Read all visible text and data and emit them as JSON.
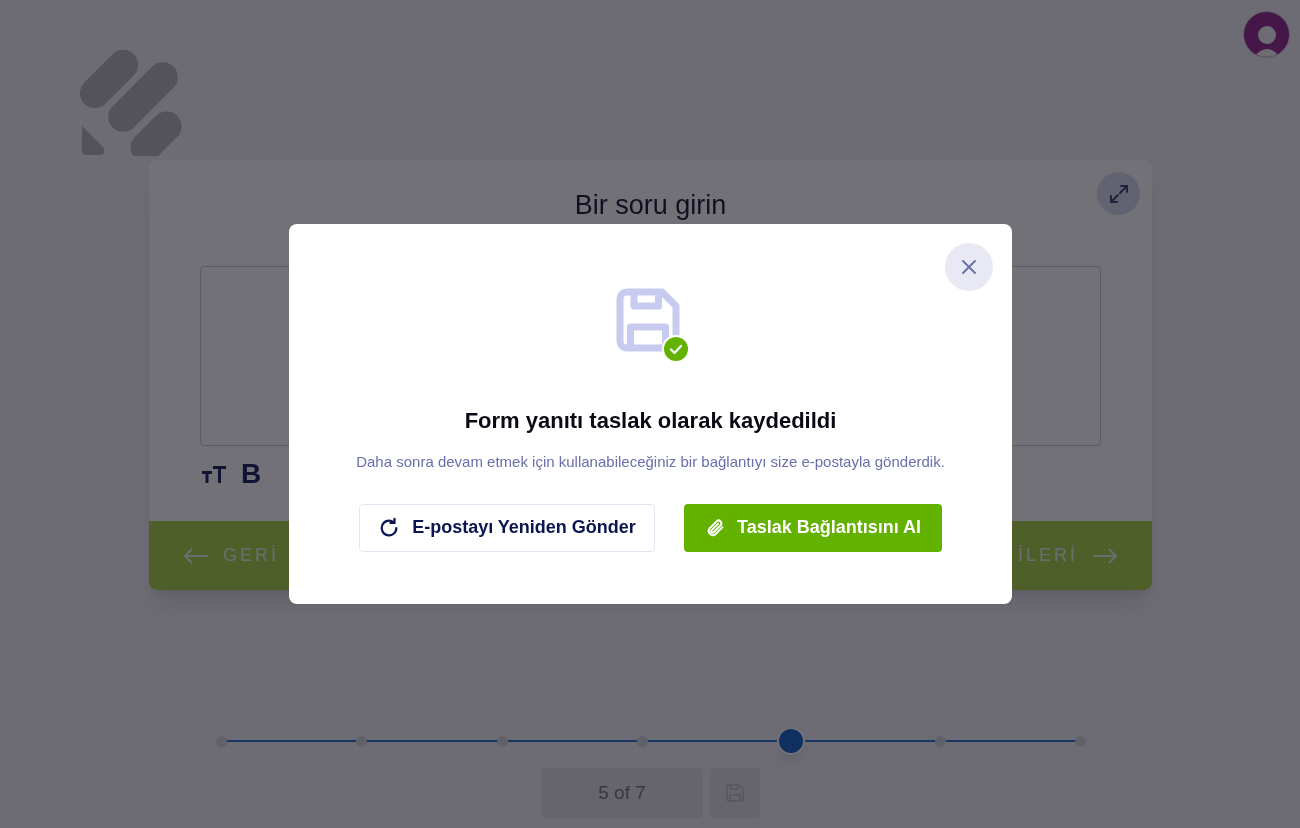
{
  "question": {
    "title": "Bir soru girin",
    "toolbar": [
      {
        "kind": "icon"
      },
      {
        "kind": "text",
        "label": "B"
      }
    ]
  },
  "navigation": {
    "back": "GERİ",
    "next": "İLERİ"
  },
  "progress": {
    "steps": [
      {
        "selected": false
      },
      {
        "selected": false
      },
      {
        "selected": false
      },
      {
        "selected": false
      },
      {
        "selected": true
      },
      {
        "selected": false
      },
      {
        "selected": false
      }
    ],
    "page_label": "5 of 7"
  },
  "modal": {
    "title": "Form yanıtı taslak olarak kaydedildi",
    "message": "Daha sonra devam etmek için kullanabileceğiniz bir bağlantıyı size e-postayla gönderdik.",
    "buttons": [
      {
        "kind": "secondary",
        "label": "E-postayı Yeniden Gönder"
      },
      {
        "kind": "primary",
        "label": "Taslak Bağlantısını Al"
      }
    ]
  }
}
